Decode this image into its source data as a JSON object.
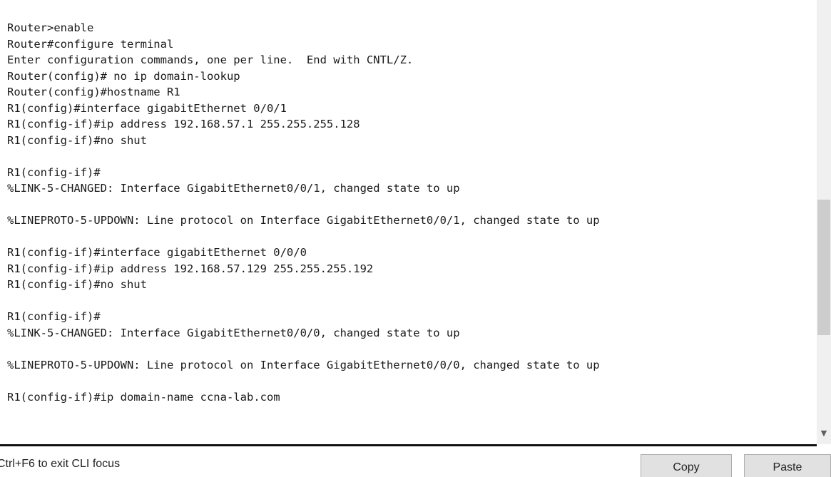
{
  "terminal": {
    "lines": [
      "Router>enable",
      "Router#configure terminal",
      "Enter configuration commands, one per line.  End with CNTL/Z.",
      "Router(config)# no ip domain-lookup",
      "Router(config)#hostname R1",
      "R1(config)#interface gigabitEthernet 0/0/1",
      "R1(config-if)#ip address 192.168.57.1 255.255.255.128",
      "R1(config-if)#no shut",
      "",
      "R1(config-if)#",
      "%LINK-5-CHANGED: Interface GigabitEthernet0/0/1, changed state to up",
      "",
      "%LINEPROTO-5-UPDOWN: Line protocol on Interface GigabitEthernet0/0/1, changed state to up",
      "",
      "R1(config-if)#interface gigabitEthernet 0/0/0",
      "R1(config-if)#ip address 192.168.57.129 255.255.255.192",
      "R1(config-if)#no shut",
      "",
      "R1(config-if)#",
      "%LINK-5-CHANGED: Interface GigabitEthernet0/0/0, changed state to up",
      "",
      "%LINEPROTO-5-UPDOWN: Line protocol on Interface GigabitEthernet0/0/0, changed state to up",
      "",
      "R1(config-if)#ip domain-name ccna-lab.com"
    ]
  },
  "scrollbar": {
    "down_arrow_icon": "chevron-down-icon"
  },
  "footer": {
    "hint": "Ctrl+F6 to exit CLI focus",
    "copy_label": "Copy",
    "paste_label": "Paste"
  }
}
